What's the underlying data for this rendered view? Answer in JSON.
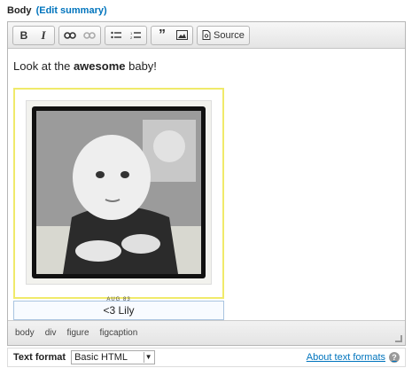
{
  "field": {
    "label": "Body",
    "edit_summary": "(Edit summary)"
  },
  "toolbar": {
    "bold": "B",
    "italic": "I",
    "source": "Source"
  },
  "content": {
    "text_before": "Look at the ",
    "text_bold": "awesome",
    "text_after": " baby!",
    "photo_caption": "AUG  83",
    "figcaption": "<3 Lily"
  },
  "status": {
    "path": [
      "body",
      "div",
      "figure",
      "figcaption"
    ]
  },
  "format": {
    "label": "Text format",
    "selected": "Basic HTML",
    "about": "About text formats"
  },
  "colors": {
    "accent": "#0074bd",
    "figure_outline": "#f0ea6a",
    "caption_outline": "#a9c4e0"
  }
}
